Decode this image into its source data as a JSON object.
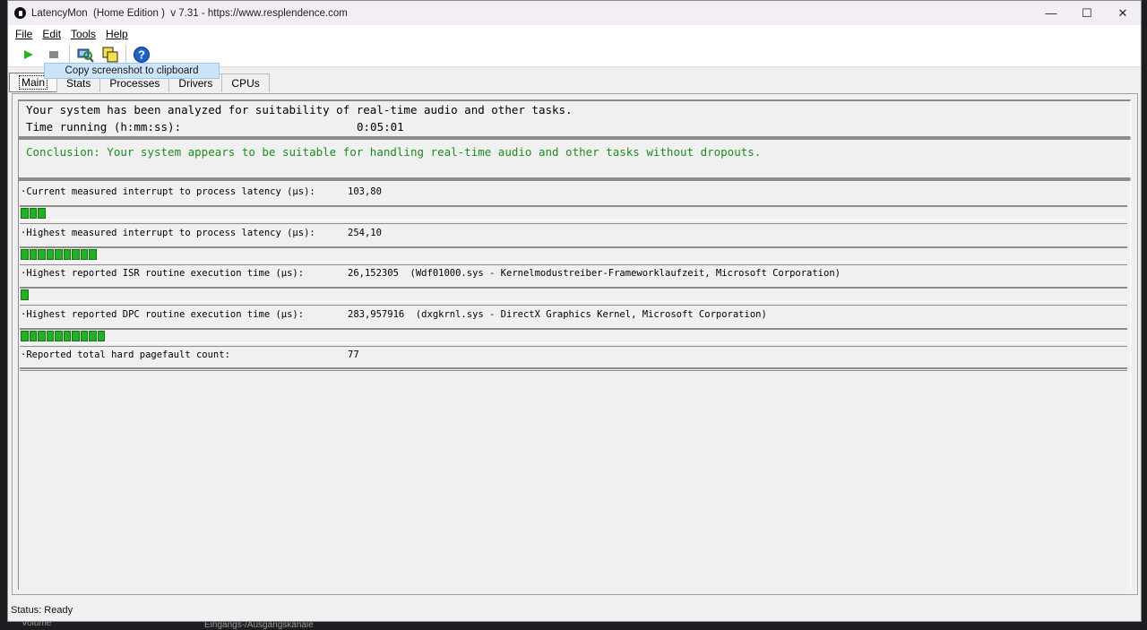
{
  "window": {
    "title": "LatencyMon  (Home Edition )  v 7.31 - https://www.resplendence.com",
    "minimize": "—",
    "maximize": "☐",
    "close": "✕"
  },
  "menu": [
    {
      "label": "File"
    },
    {
      "label": "Edit"
    },
    {
      "label": "Tools"
    },
    {
      "label": "Help"
    }
  ],
  "toolbar": {
    "tooltip": "Copy screenshot to clipboard",
    "colors": {
      "play": "#22b822",
      "stop": "#8a8a8a",
      "help": "#1f5fc8"
    }
  },
  "tabs": [
    {
      "label": "Main",
      "active": true
    },
    {
      "label": "Stats"
    },
    {
      "label": "Processes"
    },
    {
      "label": "Drivers"
    },
    {
      "label": "CPUs"
    }
  ],
  "summary": {
    "analysis_line": "Your system has been analyzed for suitability of real-time audio and other tasks.",
    "time_label": "Time running (h:mm:ss):",
    "time_value": "0:05:01",
    "conclusion": "Conclusion: Your system appears to be suitable for handling real-time audio and other tasks without dropouts."
  },
  "metrics": [
    {
      "label": "·Current measured interrupt to process latency (µs):",
      "value": "103,80",
      "segments": 3
    },
    {
      "label": "·Highest measured interrupt to process latency (µs):",
      "value": "254,10",
      "segments": 9
    },
    {
      "label": "·Highest reported ISR routine execution time (µs):",
      "value": "26,152305  (Wdf01000.sys - Kernelmodustreiber-Frameworklaufzeit, Microsoft Corporation)",
      "segments": 1
    },
    {
      "label": "·Highest reported DPC routine execution time (µs):",
      "value": "283,957916  (dxgkrnl.sys - DirectX Graphics Kernel, Microsoft Corporation)",
      "segments": 10
    },
    {
      "label": "·Reported total hard pagefault count:",
      "value": "77",
      "segments": 0
    }
  ],
  "status": "Status: Ready",
  "backdrop": {
    "left": "Volume",
    "right": "Eingangs-/Ausgangskanäle"
  }
}
